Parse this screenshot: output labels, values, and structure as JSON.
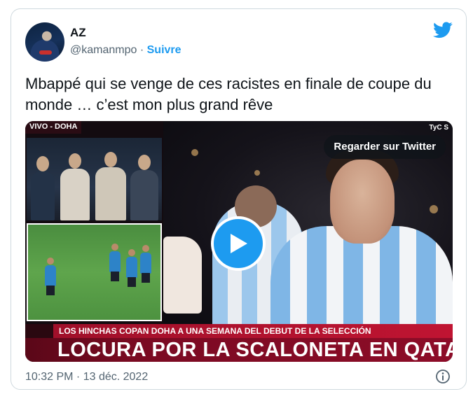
{
  "author": {
    "name": "AZ",
    "handle": "@kamanmpo",
    "separator": "·",
    "follow_label": "Suivre"
  },
  "tweet": {
    "text": "Mbappé qui se venge de ces racistes en finale de coupe du monde … c’est mon plus grand rêve",
    "timestamp": "10:32 PM · 13 déc. 2022"
  },
  "media": {
    "live_label": "VIVO - DOHA",
    "corner_logo": "TyC S",
    "watch_label": "Regarder sur Twitter",
    "ticker_small": "LOS HINCHAS COPAN DOHA A UNA SEMANA DEL DEBUT DE LA SELECCIÓN",
    "ticker_big": "LOCURA POR LA SCALONETA EN QATA"
  },
  "icons": {
    "brand": "twitter-bird-icon",
    "play": "play-icon",
    "info": "info-icon"
  },
  "colors": {
    "accent": "#1d9bf0",
    "text": "#0f1419",
    "muted": "#536471",
    "ticker": "#8d0c28"
  }
}
